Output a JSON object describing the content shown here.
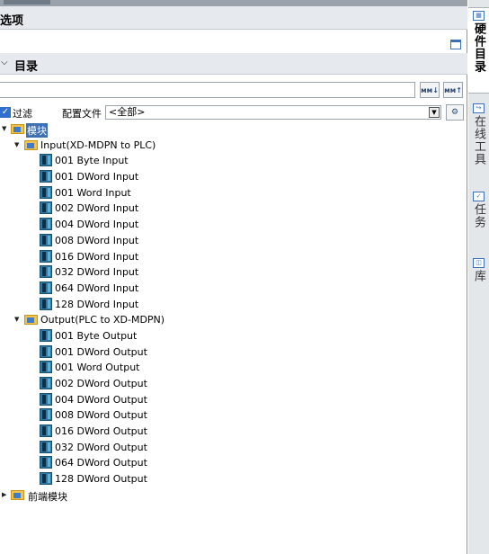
{
  "panel": {
    "options_title": "选项",
    "catalog_title": "目录"
  },
  "search": {
    "value": "",
    "placeholder": ""
  },
  "toolbar": {
    "search_down_label": "ᴍᴍ↓",
    "search_up_label": "ᴍᴍ↑"
  },
  "filter": {
    "checked": true,
    "label": "过滤",
    "config_label": "配置文件",
    "config_value": "<全部>"
  },
  "tree": {
    "root_label": "模块",
    "input_folder": "Input(XD-MDPN to PLC)",
    "input_items": [
      "001 Byte Input",
      "001 DWord Input",
      "001 Word Input",
      "002 DWord Input",
      "004 DWord Input",
      "008 DWord Input",
      "016 DWord Input",
      "032 DWord Input",
      "064 DWord Input",
      "128 DWord Input"
    ],
    "output_folder": "Output(PLC to XD-MDPN)",
    "output_items": [
      "001 Byte Output",
      "001 DWord Output",
      "001 Word Output",
      "002 DWord Output",
      "004 DWord Output",
      "008 DWord Output",
      "016 DWord Output",
      "032 DWord Output",
      "064 DWord Output",
      "128 DWord Output"
    ],
    "frontend_label": "前端模块"
  },
  "side_tabs": [
    {
      "label": "硬件目录",
      "icon": "catalog-icon",
      "active": true
    },
    {
      "label": "在线工具",
      "icon": "online-tools-icon",
      "active": false
    },
    {
      "label": "任务",
      "icon": "tasks-icon",
      "active": false
    },
    {
      "label": "库",
      "icon": "library-icon",
      "active": false
    }
  ]
}
